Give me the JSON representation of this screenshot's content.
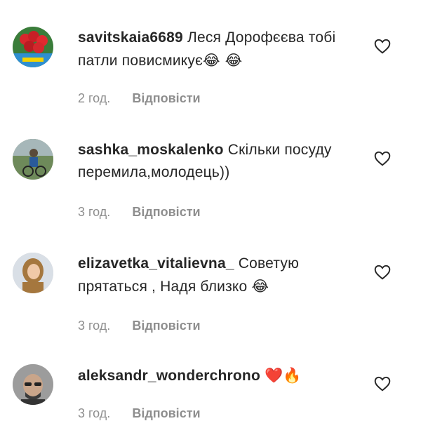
{
  "comments": [
    {
      "username": "savitskaia6689",
      "text_before": "Леся Дорофєєва тобі патли повисмикує",
      "text_emoji": "😂 😂",
      "time": "2 год.",
      "reply": "Відповісти",
      "avatar_icon": "flowers-avatar"
    },
    {
      "username": "sashka_moskalenko",
      "text_before": "Скільки посуду перемила,молодець))",
      "text_emoji": "",
      "time": "3 год.",
      "reply": "Відповісти",
      "avatar_icon": "bike-avatar"
    },
    {
      "username": "elizavetka_vitalievna_",
      "text_before": "Советую прятаться , Надя близко",
      "text_emoji": "😂",
      "time": "3 год.",
      "reply": "Відповісти",
      "avatar_icon": "girl-avatar"
    },
    {
      "username": "aleksandr_wonderchrono",
      "text_before": "",
      "text_emoji": "❤️🔥",
      "time": "3 год.",
      "reply": "Відповісти",
      "avatar_icon": "man-avatar"
    }
  ],
  "colors": {
    "text": "#262626",
    "meta": "#8e8e8e",
    "like_stroke": "#262626"
  }
}
